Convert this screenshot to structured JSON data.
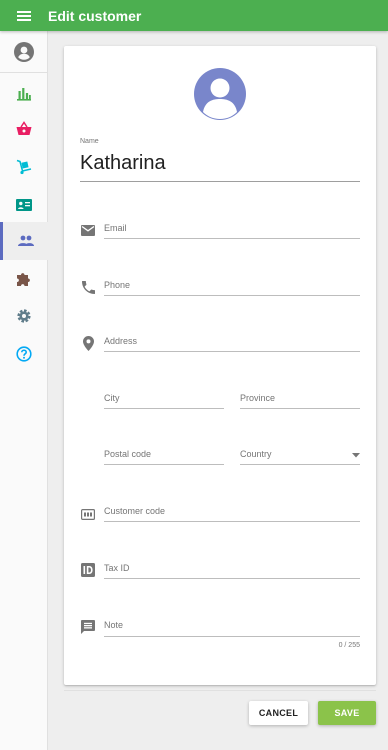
{
  "app_bar": {
    "title": "Edit customer",
    "color": "#4caf50"
  },
  "sidebar": {
    "items": [
      {
        "icon": "account-circle-icon",
        "name": "sidebar-item-account",
        "color": "#757575"
      },
      {
        "icon": "bar-chart-icon",
        "name": "sidebar-item-reports",
        "color": "#4caf50"
      },
      {
        "icon": "basket-icon",
        "name": "sidebar-item-sales",
        "color": "#e91e63"
      },
      {
        "icon": "dolly-icon",
        "name": "sidebar-item-purchases",
        "color": "#00bcd4"
      },
      {
        "icon": "contact-card-icon",
        "name": "sidebar-item-contacts",
        "color": "#009688"
      },
      {
        "icon": "people-icon",
        "name": "sidebar-item-customers",
        "color": "#5c6bc0",
        "active": true
      },
      {
        "icon": "puzzle-icon",
        "name": "sidebar-item-extensions",
        "color": "#795548"
      },
      {
        "icon": "gear-icon",
        "name": "sidebar-item-settings",
        "color": "#607d8b"
      },
      {
        "icon": "help-icon",
        "name": "sidebar-item-help",
        "color": "#03a9f4"
      }
    ]
  },
  "form": {
    "avatar_color": "#7986cb",
    "name_label": "Name",
    "name_value": "Katharina",
    "email_placeholder": "Email",
    "phone_placeholder": "Phone",
    "address_placeholder": "Address",
    "city_placeholder": "City",
    "province_placeholder": "Province",
    "postal_code_placeholder": "Postal code",
    "country_placeholder": "Country",
    "customer_code_placeholder": "Customer code",
    "tax_id_placeholder": "Tax ID",
    "note_placeholder": "Note",
    "note_counter": "0 / 255"
  },
  "actions": {
    "cancel_label": "CANCEL",
    "save_label": "SAVE",
    "save_color": "#8bc34a"
  }
}
